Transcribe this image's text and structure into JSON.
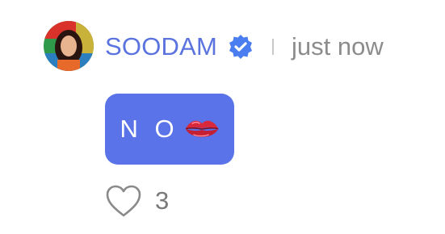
{
  "comment": {
    "author": {
      "name": "SOODAM",
      "verified": true,
      "avatar": "profile-photo"
    },
    "timestamp": "just now",
    "message": "N O",
    "message_emoji": "lips-emoji",
    "likes": {
      "icon": "heart-outline-icon",
      "count": "3"
    }
  },
  "colors": {
    "username": "#5b73de",
    "bubble": "#5b73e8",
    "verified_badge": "#4a7ef0",
    "timestamp": "#8c8c8c",
    "like_icon": "#8a8a8a"
  }
}
